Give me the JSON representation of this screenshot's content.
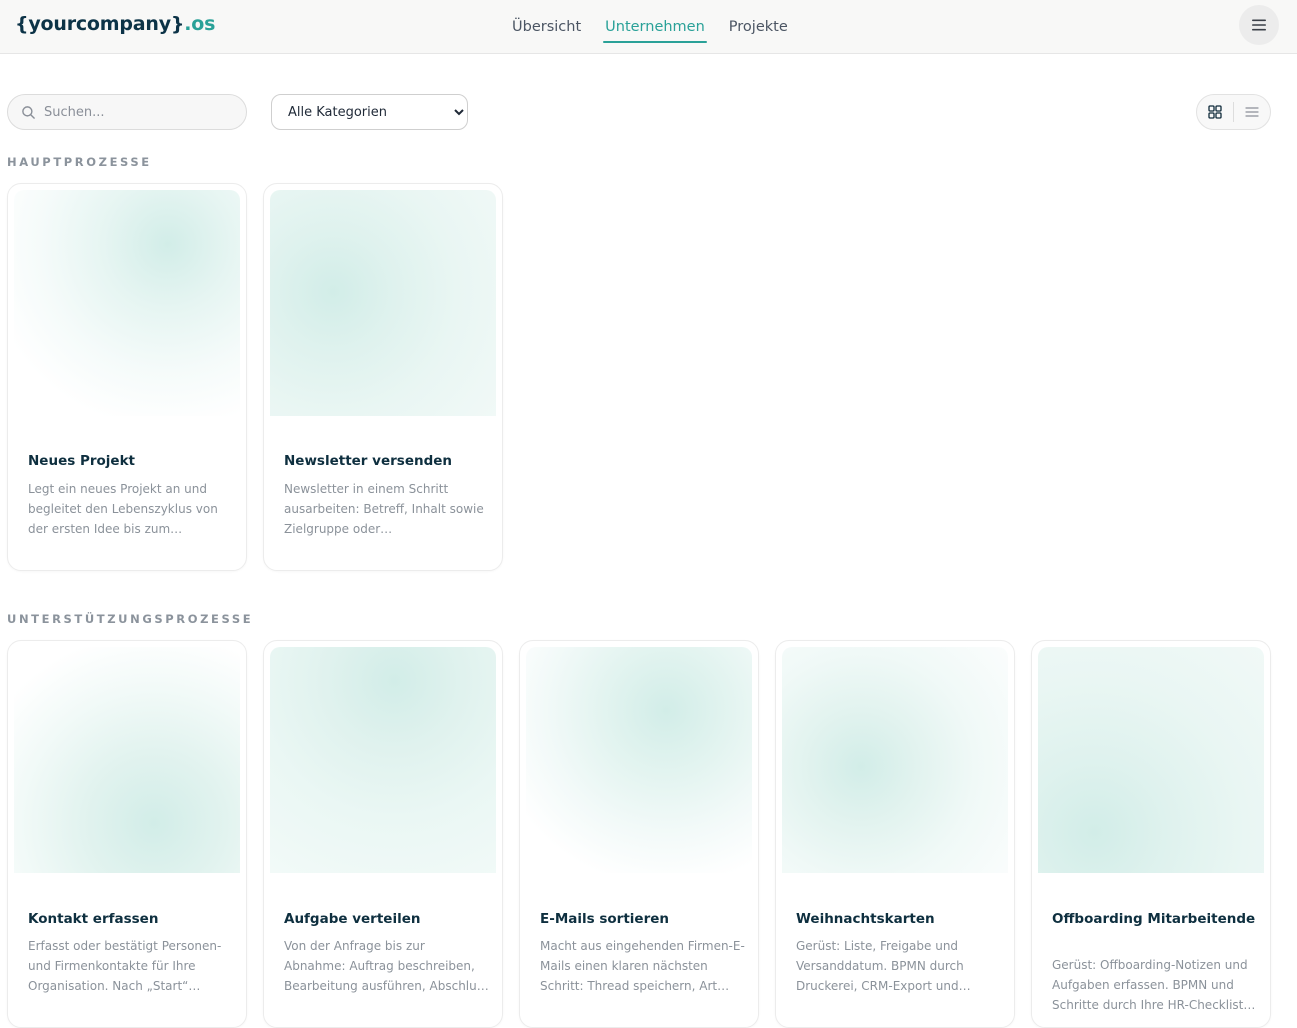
{
  "header": {
    "logo_brand": "{yourcompany}",
    "logo_suffix": ".os",
    "nav": [
      {
        "label": "Übersicht",
        "active": false
      },
      {
        "label": "Unternehmen",
        "active": true
      },
      {
        "label": "Projekte",
        "active": false
      }
    ],
    "menu_icon": "hamburger-menu-icon"
  },
  "toolbar": {
    "search_placeholder": "Suchen...",
    "search_icon": "search-icon",
    "category_selected": "Alle Kategorien",
    "view_grid_icon": "grid-view-icon",
    "view_list_icon": "list-view-icon"
  },
  "sections": [
    {
      "title": "HAUPTPROZESSE",
      "cards": [
        {
          "title": "Neues Projekt",
          "description": "Legt ein neues Projekt an und begleitet den Lebenszyklus von der ersten Idee bis zum…"
        },
        {
          "title": "Newsletter versenden",
          "description": "Newsletter in einem Schritt ausarbeiten: Betreff, Inhalt sowie Zielgruppe oder…"
        }
      ]
    },
    {
      "title": "UNTERSTÜTZUNGSPROZESSE",
      "cards": [
        {
          "title": "Kontakt erfassen",
          "description": "Erfasst oder bestätigt Personen- und Firmenkontakte für Ihre Organisation. Nach „Start“ öffnet…"
        },
        {
          "title": "Aufgabe verteilen",
          "description": "Von der Anfrage bis zur Abnahme: Auftrag beschreiben, Bearbeitung ausführen, Abschluss bestätigen…"
        },
        {
          "title": "E-Mails sortieren",
          "description": "Macht aus eingehenden Firmen-E-Mails einen klaren nächsten Schritt: Thread speichern, Art un…"
        },
        {
          "title": "Weihnachtskarten",
          "description": "Gerüst: Liste, Freigabe und Versanddatum. BPMN durch Druckerei, CRM-Export und…"
        },
        {
          "title": "Offboarding Mitarbeitende",
          "description": "Gerüst: Offboarding-Notizen und Aufgaben erfassen. BPMN und Schritte durch Ihre HR-Checklist…"
        }
      ]
    }
  ],
  "colors": {
    "accent": "#2aa198",
    "brand": "#0c3347",
    "thumb_tint": "#d2ede8"
  }
}
